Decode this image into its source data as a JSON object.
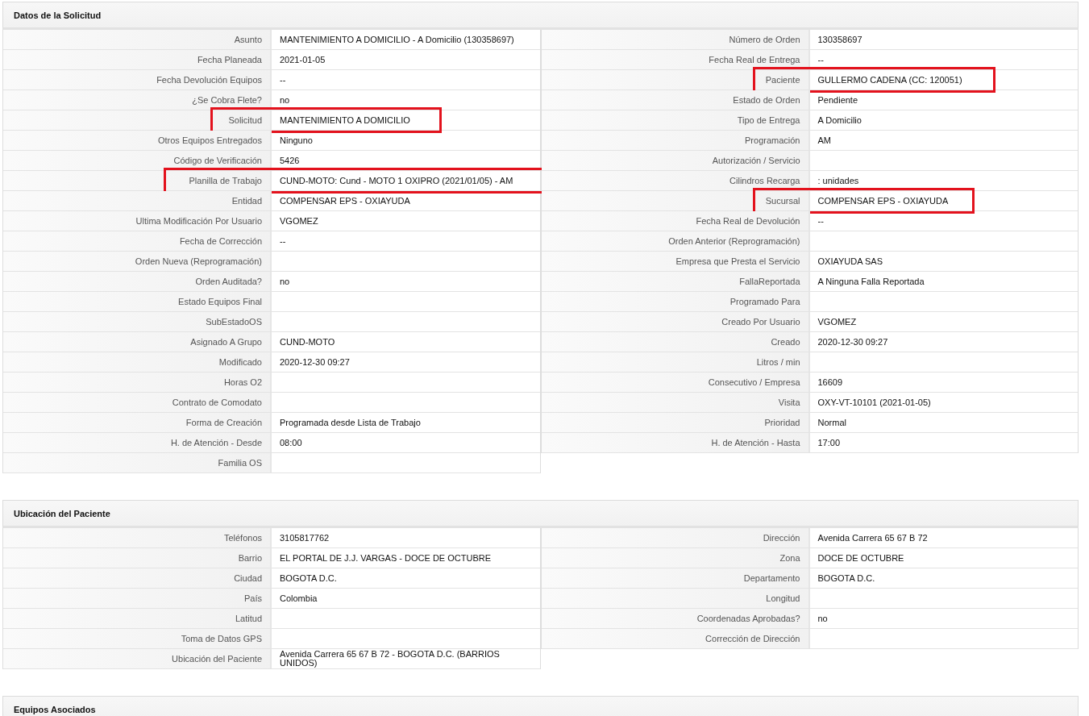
{
  "sections": [
    {
      "title": "Datos de la Solicitud",
      "columns": [
        [
          {
            "label": "Asunto",
            "value": "MANTENIMIENTO A DOMICILIO - A Domicilio (130358697)",
            "highlighted": false
          },
          {
            "label": "Fecha Planeada",
            "value": "2021-01-05",
            "highlighted": false
          },
          {
            "label": "Fecha Devolución Equipos",
            "value": "--",
            "highlighted": false
          },
          {
            "label": "¿Se Cobra Flete?",
            "value": "no",
            "highlighted": false
          },
          {
            "label": "Solicitud",
            "value": "MANTENIMIENTO A DOMICILIO",
            "highlighted": true
          },
          {
            "label": "Otros Equipos Entregados",
            "value": "Ninguno",
            "highlighted": false
          },
          {
            "label": "Código de Verificación",
            "value": "5426",
            "highlighted": false
          },
          {
            "label": "Planilla de Trabajo",
            "value": "CUND-MOTO: Cund - MOTO 1 OXIPRO (2021/01/05) - AM",
            "highlighted": true
          },
          {
            "label": "Entidad",
            "value": "COMPENSAR EPS - OXIAYUDA",
            "highlighted": false
          },
          {
            "label": "Ultima Modificación Por Usuario",
            "value": "VGOMEZ",
            "highlighted": false
          },
          {
            "label": "Fecha de Corrección",
            "value": "--",
            "highlighted": false
          },
          {
            "label": "Orden Nueva (Reprogramación)",
            "highlighted": false
          },
          {
            "label": "Orden Auditada?",
            "value": "no",
            "highlighted": false
          },
          {
            "label": "Estado Equipos Final",
            "highlighted": false
          },
          {
            "label": "SubEstadoOS",
            "highlighted": false
          },
          {
            "label": "Asignado A Grupo",
            "value": "CUND-MOTO",
            "highlighted": false
          },
          {
            "label": "Modificado",
            "value": "2020-12-30 09:27",
            "highlighted": false
          },
          {
            "label": "Horas O2",
            "highlighted": false
          },
          {
            "label": "Contrato de Comodato",
            "highlighted": false
          },
          {
            "label": "Forma de Creación",
            "value": "Programada desde Lista de Trabajo",
            "highlighted": false
          },
          {
            "label": "H. de Atención - Desde",
            "value": "08:00",
            "highlighted": false
          },
          {
            "label": "Familia OS",
            "highlighted": false
          }
        ],
        [
          {
            "label": "Número de Orden",
            "value": "130358697",
            "highlighted": false
          },
          {
            "label": "Fecha Real de Entrega",
            "value": "--",
            "highlighted": false
          },
          {
            "label": "Paciente",
            "value": "GULLERMO CADENA (CC: 120051)",
            "highlighted": true
          },
          {
            "label": "Estado de Orden",
            "value": "Pendiente",
            "highlighted": false
          },
          {
            "label": "Tipo de Entrega",
            "value": "A Domicilio",
            "highlighted": false
          },
          {
            "label": "Programación",
            "value": "AM",
            "highlighted": false
          },
          {
            "label": "Autorización / Servicio",
            "highlighted": false
          },
          {
            "label": "Cilindros Recarga",
            "value": ": unidades",
            "highlighted": false
          },
          {
            "label": "Sucursal",
            "value": "COMPENSAR EPS - OXIAYUDA",
            "highlighted": true
          },
          {
            "label": "Fecha Real de Devolución",
            "value": "--",
            "highlighted": false
          },
          {
            "label": "Orden Anterior (Reprogramación)",
            "highlighted": false
          },
          {
            "label": "Empresa que Presta el Servicio",
            "value": "OXIAYUDA SAS",
            "highlighted": false
          },
          {
            "label": "FallaReportada",
            "value": "A Ninguna Falla Reportada",
            "highlighted": false
          },
          {
            "label": "Programado Para",
            "highlighted": false
          },
          {
            "label": "Creado Por Usuario",
            "value": "VGOMEZ",
            "highlighted": false
          },
          {
            "label": "Creado",
            "value": "2020-12-30 09:27",
            "highlighted": false
          },
          {
            "label": "Litros / min",
            "highlighted": false
          },
          {
            "label": "Consecutivo / Empresa",
            "value": "16609",
            "highlighted": false
          },
          {
            "label": "Visita",
            "value": "OXY-VT-10101 (2021-01-05)",
            "highlighted": false
          },
          {
            "label": "Prioridad",
            "value": "Normal",
            "highlighted": false
          },
          {
            "label": "H. de Atención - Hasta",
            "value": "17:00",
            "highlighted": false
          }
        ]
      ]
    },
    {
      "title": "Ubicación del Paciente",
      "columns": [
        [
          {
            "label": "Teléfonos",
            "value": "3105817762",
            "highlighted": false
          },
          {
            "label": "Barrio",
            "value": "EL PORTAL DE J.J. VARGAS - DOCE DE OCTUBRE",
            "highlighted": false
          },
          {
            "label": "Ciudad",
            "value": "BOGOTA D.C.",
            "highlighted": false
          },
          {
            "label": "País",
            "value": "Colombia",
            "highlighted": false
          },
          {
            "label": "Latitud",
            "highlighted": false
          },
          {
            "label": "Toma de Datos GPS",
            "highlighted": false
          },
          {
            "label": "Ubicación del Paciente",
            "value": "Avenida Carrera 65 67 B 72 - BOGOTA D.C. (BARRIOS UNIDOS)",
            "highlighted": false
          }
        ],
        [
          {
            "label": "Dirección",
            "value": "Avenida Carrera 65 67 B 72",
            "highlighted": false
          },
          {
            "label": "Zona",
            "value": "DOCE DE OCTUBRE",
            "highlighted": false
          },
          {
            "label": "Departamento",
            "value": "BOGOTA D.C.",
            "highlighted": false
          },
          {
            "label": "Longitud",
            "highlighted": false
          },
          {
            "label": "Coordenadas Aprobadas?",
            "value": "no",
            "highlighted": false
          },
          {
            "label": "Corrección de Dirección",
            "highlighted": false
          }
        ]
      ]
    },
    {
      "title": "Equipos Asociados"
    }
  ]
}
